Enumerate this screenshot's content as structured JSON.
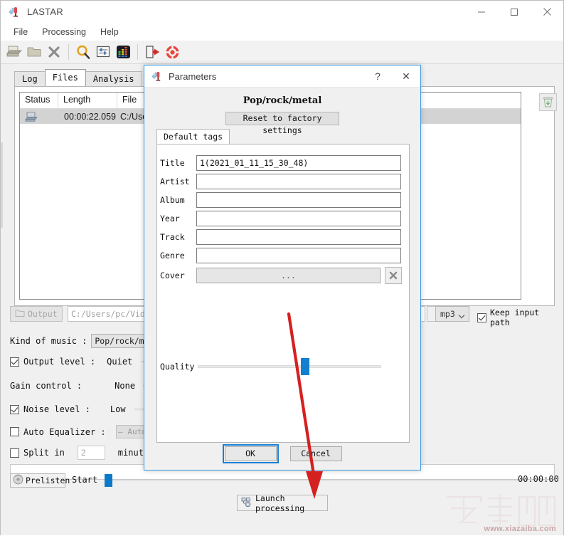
{
  "window": {
    "title": "LASTAR",
    "icon": "app-icon",
    "controls": {
      "minimize": "minimize-icon",
      "maximize": "maximize-icon",
      "close": "close-icon"
    }
  },
  "menubar": {
    "items": [
      "File",
      "Processing",
      "Help"
    ]
  },
  "toolbar": {
    "items": [
      {
        "name": "open-file-icon",
        "label": "Open file"
      },
      {
        "name": "open-folder-icon",
        "label": "Open folder"
      },
      {
        "name": "remove-icon",
        "label": "Remove"
      },
      {
        "name": "search-icon",
        "label": "Search"
      },
      {
        "name": "settings-sliders-icon",
        "label": "Settings"
      },
      {
        "name": "equalizer-icon",
        "label": "Equalizer"
      },
      {
        "name": "exit-icon",
        "label": "Exit"
      },
      {
        "name": "help-lifebuoy-icon",
        "label": "Help"
      }
    ]
  },
  "tabs": [
    {
      "label": "Log",
      "active": false
    },
    {
      "label": "Files",
      "active": true
    },
    {
      "label": "Analysis",
      "active": false
    }
  ],
  "filelist": {
    "columns": [
      "Status",
      "Length",
      "File"
    ],
    "rows": [
      {
        "status_icon": "file-status-icon",
        "length": "00:00:22.059",
        "file": "C:/Users"
      }
    ],
    "trash_button": "trash-icon"
  },
  "output": {
    "button_label": "Output",
    "button_icon": "folder-icon",
    "path_value": "C:/Users/pc/Videos",
    "format_value": "mp3",
    "format_options": [
      "mp3"
    ],
    "keep_input_path_label": "Keep input path",
    "keep_input_path_checked": true
  },
  "settings": {
    "kind_of_music_label": "Kind of music :",
    "kind_of_music_value": "Pop/rock/metal",
    "output_level_label": "Output level :",
    "output_level_checked": true,
    "output_level_value": "Quiet",
    "gain_control_label": "Gain control :",
    "gain_control_value": "None",
    "noise_level_label": "Noise level :",
    "noise_level_checked": true,
    "noise_level_value": "Low",
    "auto_equalizer_label": "Auto Equalizer :",
    "auto_equalizer_checked": false,
    "auto_equalizer_value": "— Auto —",
    "split_label": "Split in",
    "split_checked": false,
    "split_value": "2",
    "split_suffix": "minutes min"
  },
  "bottom": {
    "prelisten_label": "Prelisten",
    "prelisten_icon": "disc-icon",
    "start_label": "Start :",
    "time_label": "00:00:00",
    "launch_label": "Launch processing",
    "launch_icon": "gears-icon"
  },
  "dialog": {
    "title": "Parameters",
    "title_icon": "app-icon",
    "help_label": "?",
    "close_label": "✕",
    "heading": "Pop/rock/metal",
    "reset_label": "Reset to factory settings",
    "tab_label": "Default tags",
    "fields": [
      {
        "label": "Title",
        "value": "1(2021_01_11_15_30_48)"
      },
      {
        "label": "Artist",
        "value": ""
      },
      {
        "label": "Album",
        "value": ""
      },
      {
        "label": "Year",
        "value": ""
      },
      {
        "label": "Track",
        "value": ""
      },
      {
        "label": "Genre",
        "value": ""
      }
    ],
    "cover_label": "Cover",
    "cover_button": "...",
    "cover_clear_icon": "clear-x-icon",
    "quality_label": "Quality",
    "quality_percent": 57,
    "ok_label": "OK",
    "cancel_label": "Cancel"
  },
  "annotation": {
    "arrow_color": "#d52020"
  },
  "watermark": {
    "text": "www.xiazaiba.com"
  },
  "colors": {
    "accent": "#0a7ac8",
    "dialog_border": "#3b9ae1",
    "selected_row": "#d3d3d3"
  }
}
